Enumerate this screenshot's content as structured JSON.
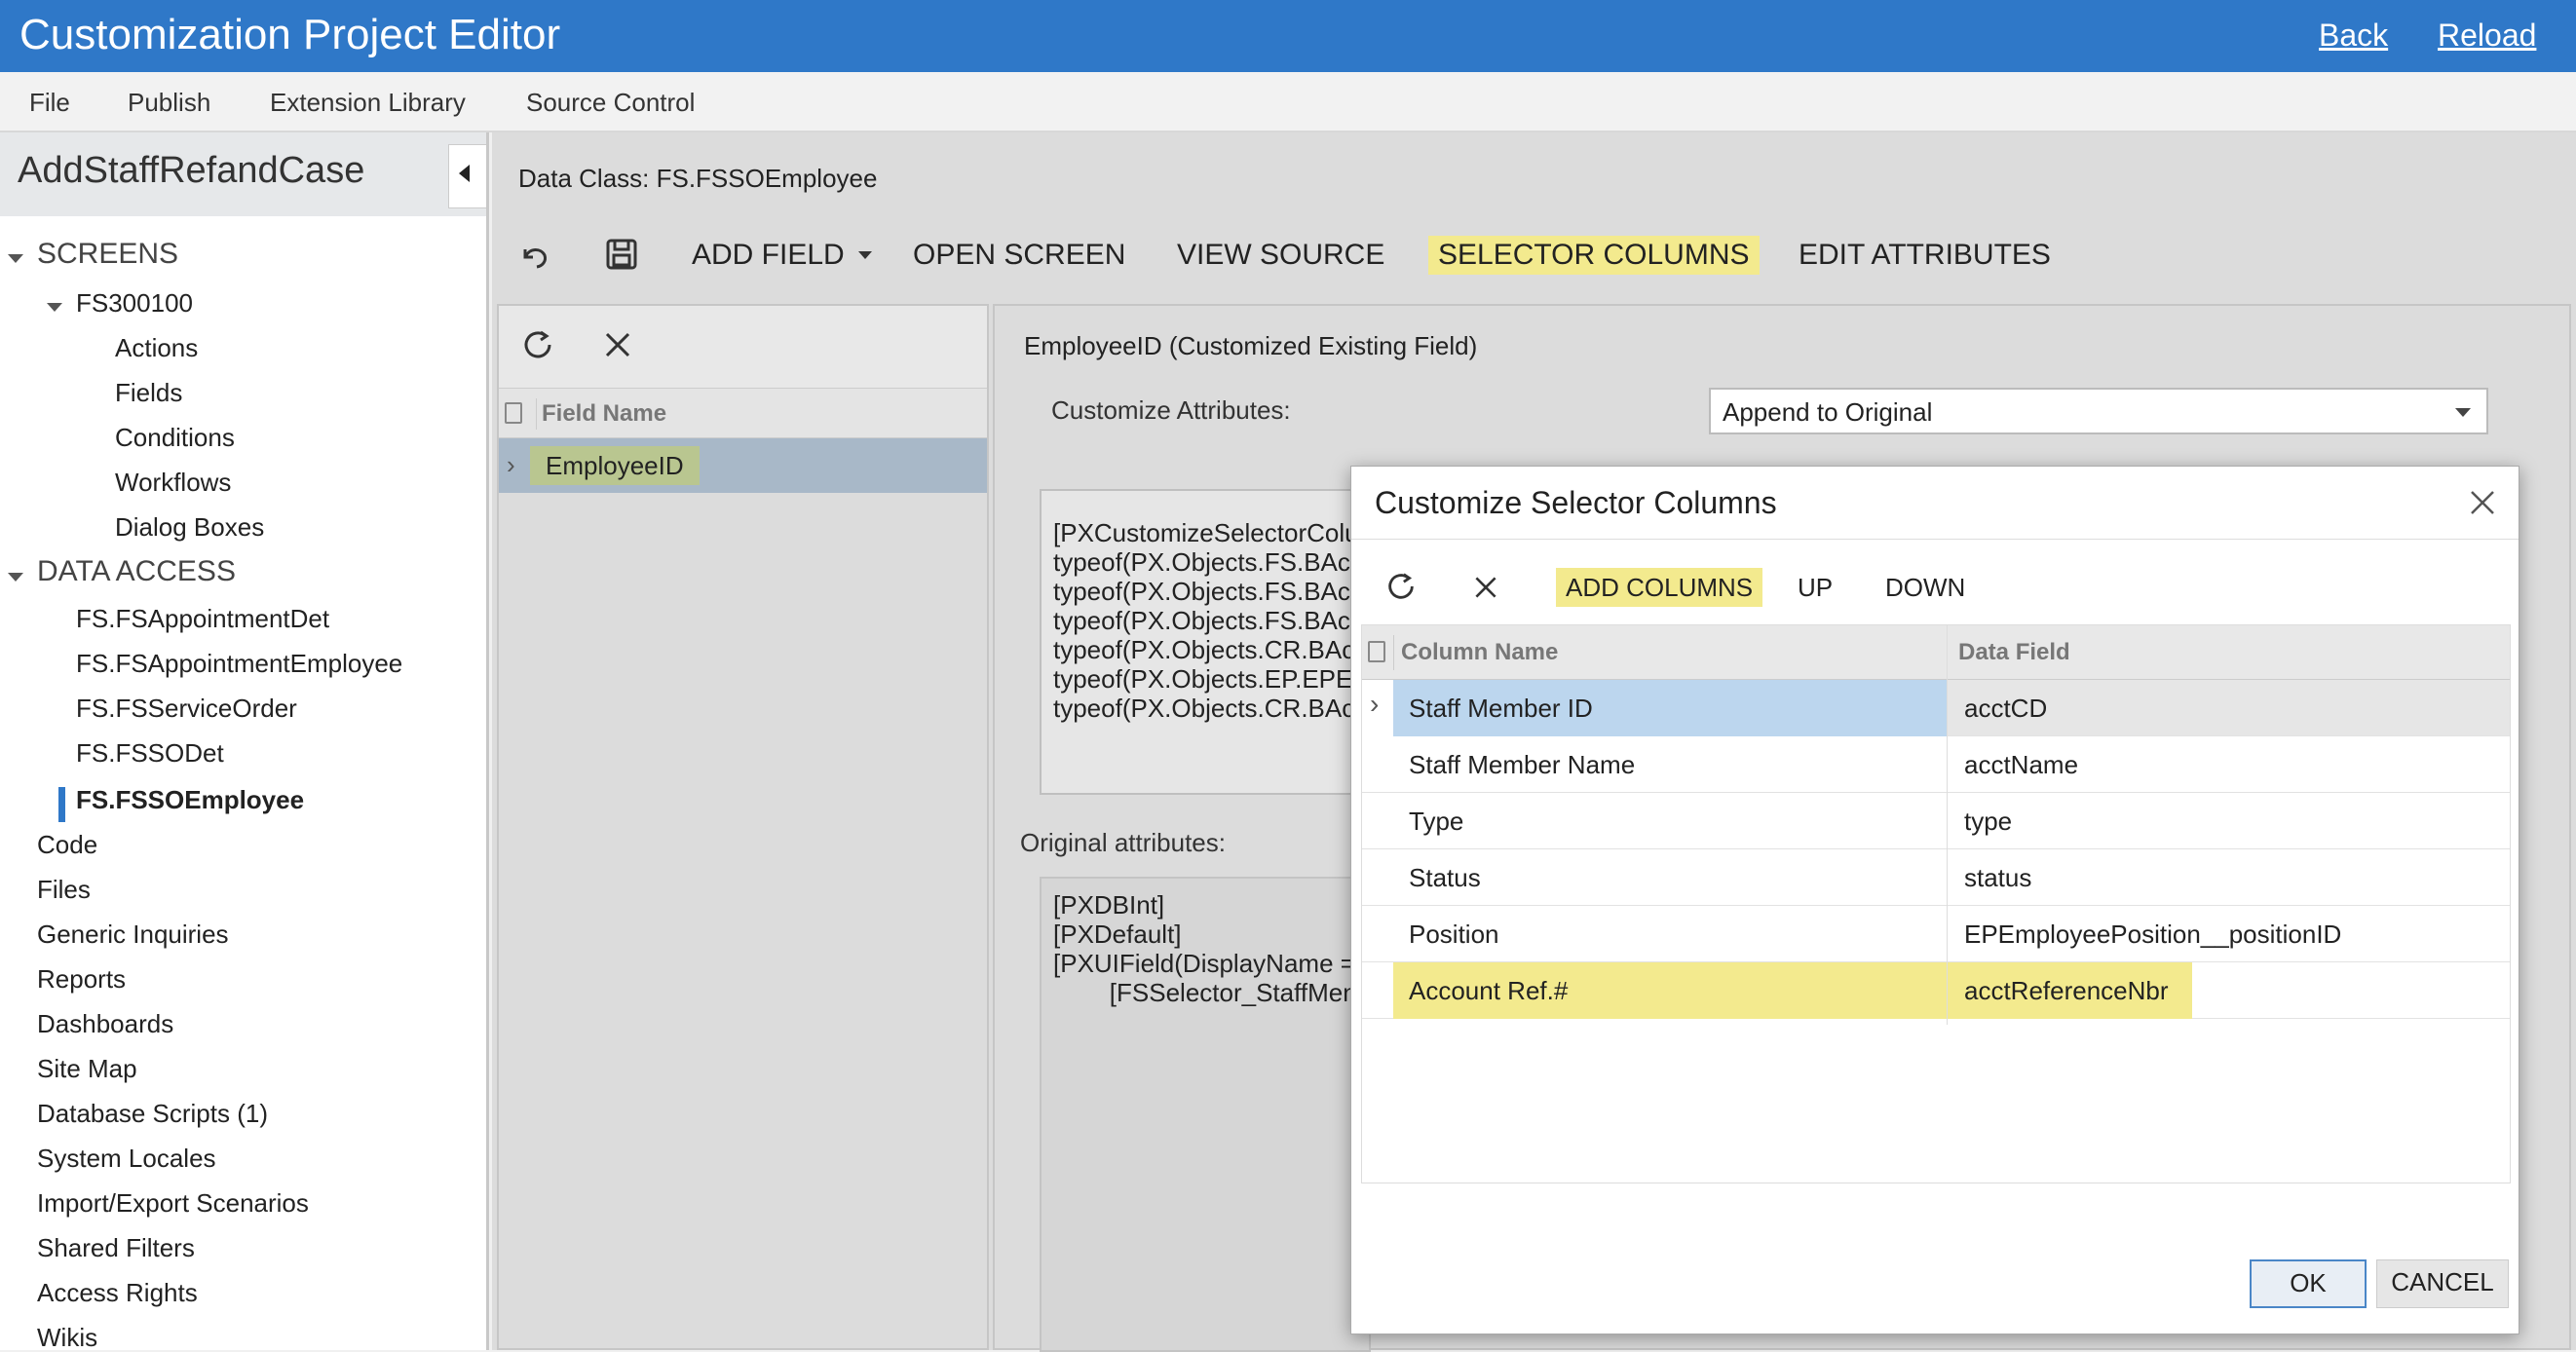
{
  "app": {
    "title": "Customization Project Editor",
    "links": {
      "back": "Back",
      "reload": "Reload"
    },
    "accent_color": "#2f78c8"
  },
  "menu": [
    "File",
    "Publish",
    "Extension Library",
    "Source Control"
  ],
  "sidebar": {
    "project_name": "AddStaffRefandCase",
    "screens_label": "SCREENS",
    "screen_id": "FS300100",
    "screen_children": [
      "Actions",
      "Fields",
      "Conditions",
      "Workflows",
      "Dialog Boxes"
    ],
    "data_access_label": "DATA ACCESS",
    "data_access_items": [
      "FS.FSAppointmentDet",
      "FS.FSAppointmentEmployee",
      "FS.FSServiceOrder",
      "FS.FSSODet",
      "FS.FSSOEmployee"
    ],
    "selected_item": "FS.FSSOEmployee",
    "other_items": [
      "Code",
      "Files",
      "Generic Inquiries",
      "Reports",
      "Dashboards",
      "Site Map",
      "Database Scripts (1)",
      "System Locales",
      "Import/Export Scenarios",
      "Shared Filters",
      "Access Rights",
      "Wikis"
    ]
  },
  "main": {
    "data_class_label": "Data Class: FS.FSSOEmployee",
    "toolbar": {
      "add_field": "ADD FIELD",
      "open_screen": "OPEN SCREEN",
      "view_source": "VIEW SOURCE",
      "selector_columns": "SELECTOR COLUMNS",
      "edit_attributes": "EDIT ATTRIBUTES"
    },
    "field_grid": {
      "header": "Field Name",
      "rows": [
        "EmployeeID"
      ]
    },
    "detail": {
      "heading": "EmployeeID (Customized Existing Field)",
      "customize_attributes_label": "Customize Attributes:",
      "customize_attributes_value": "Append to Original",
      "custom_code_lines": [
        "[PXCustomizeSelectorColu",
        "typeof(PX.Objects.FS.BAc",
        "typeof(PX.Objects.FS.BAc",
        "typeof(PX.Objects.FS.BAc",
        "typeof(PX.Objects.CR.BAc",
        "typeof(PX.Objects.EP.EPE",
        "typeof(PX.Objects.CR.BAc"
      ],
      "original_attributes_label": "Original attributes:",
      "original_code_lines": [
        "[PXDBInt]",
        "[PXDefault]",
        "[PXUIField(DisplayName =",
        "        [FSSelector_StaffMen"
      ]
    }
  },
  "dialog": {
    "title": "Customize Selector Columns",
    "toolbar": {
      "add_columns": "ADD COLUMNS",
      "up": "UP",
      "down": "DOWN"
    },
    "columns": {
      "column_name": "Column Name",
      "data_field": "Data Field"
    },
    "rows": [
      {
        "column_name": "Staff Member ID",
        "data_field": "acctCD"
      },
      {
        "column_name": "Staff Member Name",
        "data_field": "acctName"
      },
      {
        "column_name": "Type",
        "data_field": "type"
      },
      {
        "column_name": "Status",
        "data_field": "status"
      },
      {
        "column_name": "Position",
        "data_field": "EPEmployeePosition__positionID"
      },
      {
        "column_name": "Account Ref.#",
        "data_field": "acctReferenceNbr"
      }
    ],
    "ok_label": "OK",
    "cancel_label": "CANCEL",
    "highlight_color": "#f3ea8e",
    "selected_row_color": "#bcd6ee"
  }
}
